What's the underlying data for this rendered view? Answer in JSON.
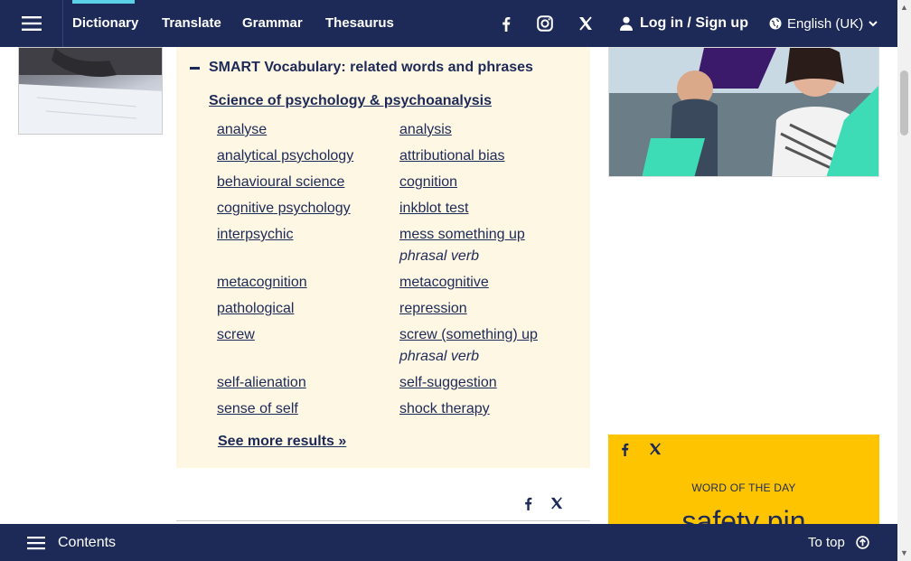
{
  "nav": {
    "items": [
      "Dictionary",
      "Translate",
      "Grammar",
      "Thesaurus"
    ],
    "login": "Log in / Sign up",
    "language": "English (UK)"
  },
  "smart_vocab": {
    "title": "SMART Vocabulary: related words and phrases",
    "subtitle": "Science of psychology & psychoanalysis",
    "left": [
      "analyse",
      "analytical psychology",
      "behavioural science",
      "cognitive psychology",
      "interpsychic",
      "metacognition",
      "pathological",
      "screw",
      "self-alienation",
      "sense of self"
    ],
    "right": [
      "analysis",
      "attributional bias",
      "cognition",
      "inkblot test",
      "mess something up",
      "metacognitive",
      "repression",
      "screw (something) up",
      "self-suggestion",
      "shock therapy"
    ],
    "phrasal_verb_label": "phrasal verb",
    "see_more": "See more results »"
  },
  "wotd": {
    "label": "WORD OF THE DAY",
    "word": "safety pin"
  },
  "bottom": {
    "contents": "Contents",
    "to_top": "To top"
  }
}
